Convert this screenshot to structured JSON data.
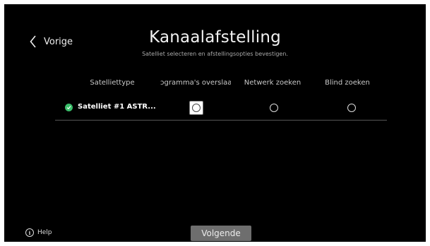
{
  "header": {
    "back_label": "Vorige",
    "title": "Kanaalafstelling",
    "subtitle": "Satelliet selecteren en afstellingsopties bevestigen."
  },
  "table": {
    "columns": [
      "Satelliettype",
      "ɔgramma's overslaan",
      "Netwerk zoeken",
      "Blind zoeken"
    ],
    "rows": [
      {
        "satellite": "Satelliet #1 ASTR...",
        "status": "selected",
        "skip_programs": false,
        "network_search": false,
        "blind_search": false
      }
    ]
  },
  "footer": {
    "help_label": "Help",
    "next_label": "Volgende"
  },
  "colors": {
    "background": "#000000",
    "check": "#3bbf6b",
    "button": "#6e6e6e"
  }
}
